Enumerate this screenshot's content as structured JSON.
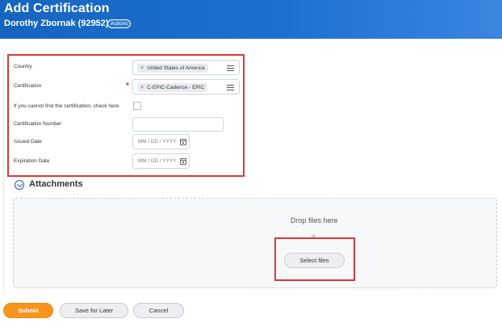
{
  "header": {
    "title": "Add Certification",
    "subtitle": "Dorothy Zbornak (92952)",
    "actions_label": "Actions"
  },
  "form": {
    "country": {
      "label": "Country",
      "value": "United States of America",
      "remove_glyph": "×"
    },
    "certification": {
      "label": "Certification",
      "required_marker": "*",
      "value": "C-EPIC-Cadence - EPIC",
      "remove_glyph": "×"
    },
    "not_found": {
      "label": "If you cannot find the certification, check here",
      "checked": false
    },
    "certification_number": {
      "label": "Certification Number",
      "value": ""
    },
    "issued_date": {
      "label": "Issued Date",
      "placeholder": "MM / DD / YYYY"
    },
    "expiration_date": {
      "label": "Expiration Date",
      "placeholder": "MM / DD / YYYY"
    }
  },
  "attachments": {
    "title": "Attachments",
    "drop_text": "Drop files here",
    "or_text": "or",
    "select_label": "Select files"
  },
  "footer": {
    "submit_label": "Submit",
    "save_later_label": "Save for Later",
    "cancel_label": "Cancel"
  },
  "colors": {
    "header_blue": "#1565c0",
    "submit_orange": "#f7941d",
    "highlight_red": "#d93a3a",
    "required_red": "#d32f2f"
  }
}
